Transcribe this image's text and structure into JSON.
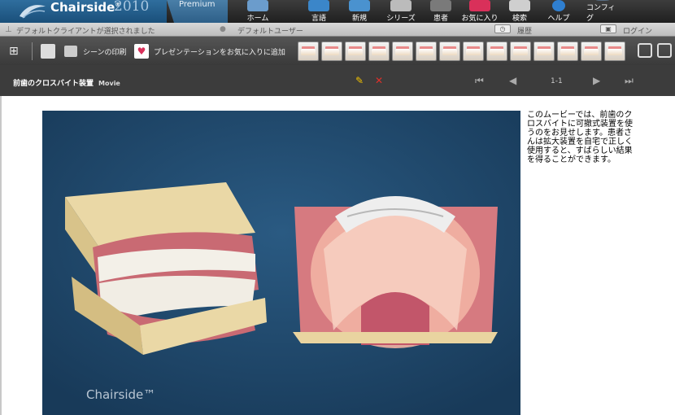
{
  "app": {
    "name": "Chairside",
    "year": "2010",
    "edition": "Premium",
    "trademark": "®"
  },
  "nav": [
    {
      "id": "home",
      "label": "ホーム",
      "icon": "tooth-home-icon"
    },
    {
      "id": "language",
      "label": "言語",
      "icon": "globe-icon"
    },
    {
      "id": "new",
      "label": "新規",
      "icon": "new-document-icon"
    },
    {
      "id": "series",
      "label": "シリーズ",
      "icon": "film-icon"
    },
    {
      "id": "patient",
      "label": "患者",
      "icon": "patient-icon"
    },
    {
      "id": "favorites",
      "label": "お気に入り",
      "icon": "heart-icon"
    },
    {
      "id": "search",
      "label": "検索",
      "icon": "search-icon"
    },
    {
      "id": "help",
      "label": "ヘルプ",
      "icon": "help-icon"
    },
    {
      "id": "config",
      "label": "コンフィグ",
      "icon": "gear-icon"
    }
  ],
  "status": {
    "client": "デフォルトクライアントが選択されました",
    "user": "デフォルトユーザー",
    "history": "履歴",
    "login": "ログイン"
  },
  "toolbar": {
    "print_scene": "シーンの印刷",
    "add_favorite": "プレゼンテーションをお気に入りに追加",
    "thumbnails_count": 14
  },
  "scene": {
    "title": "前歯のクロスバイト装置",
    "type": "Movie",
    "page": "1-1"
  },
  "description": "このムービーでは、前歯のクロスバイトに可撤式装置を使うのをお見せします。患者さんは拡大装置を自宅で正しく使用すると、すばらしい結果を得ることができます。",
  "watermark": "Chairside™"
}
